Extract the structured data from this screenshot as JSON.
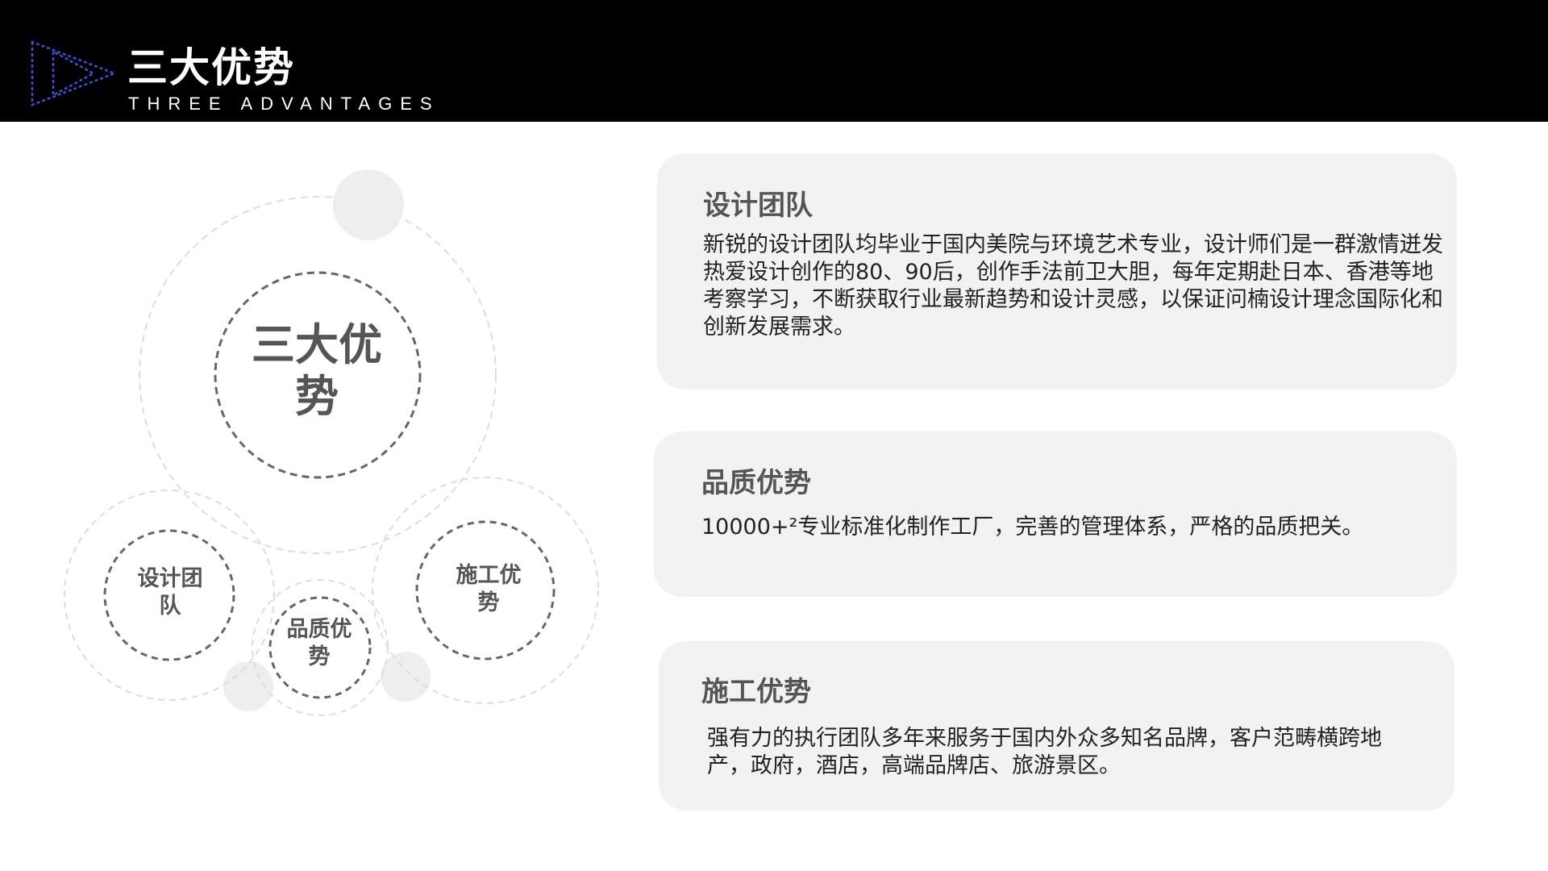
{
  "header": {
    "title": "三大优势",
    "subtitle": "THREE ADVANTAGES"
  },
  "diagram": {
    "center_label": "三大优势",
    "circles": [
      {
        "label": "设计团队"
      },
      {
        "label": "品质优势"
      },
      {
        "label": "施工优势"
      }
    ]
  },
  "cards": [
    {
      "title": "设计团队",
      "body": "新锐的设计团队均毕业于国内美院与环境艺术专业，设计师们是一群激情迸发热爱设计创作的80、90后，创作手法前卫大胆，每年定期赴日本、香港等地考察学习，不断获取行业最新趋势和设计灵感，以保证问楠设计理念国际化和创新发展需求。"
    },
    {
      "title": "品质优势",
      "body": "10000+²专业标准化制作工厂，完善的管理体系，严格的品质把关。"
    },
    {
      "title": "施工优势",
      "body": "强有力的执行团队多年来服务于国内外众多知名品牌，客户范畴横跨地产，政府，酒店，高端品牌店、旅游景区。"
    }
  ],
  "colors": {
    "header_bg": "#000000",
    "logo_stroke": "#3b4fd8",
    "card_bg": "#f2f2f2",
    "label_text": "#555555"
  }
}
